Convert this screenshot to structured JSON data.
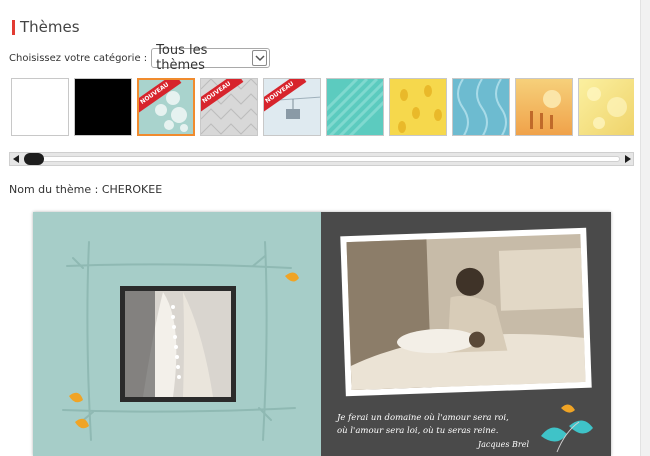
{
  "section": {
    "title": "Thèmes"
  },
  "category": {
    "label": "Choisissez votre catégorie :",
    "selected": "Tous les thèmes"
  },
  "thumbnails": [
    {
      "name": "white",
      "badge": ""
    },
    {
      "name": "black",
      "badge": ""
    },
    {
      "name": "cherokee",
      "badge": "NOUVEAU",
      "selected": true
    },
    {
      "name": "grey-geometric",
      "badge": "NOUVEAU"
    },
    {
      "name": "gondola",
      "badge": "NOUVEAU"
    },
    {
      "name": "teal-stripes",
      "badge": ""
    },
    {
      "name": "yellow-pineapples",
      "badge": ""
    },
    {
      "name": "blue-lattice",
      "badge": ""
    },
    {
      "name": "orange-sunset",
      "badge": ""
    },
    {
      "name": "yellow-bokeh",
      "badge": ""
    }
  ],
  "theme": {
    "label": "Nom du thème : CHEROKEE"
  },
  "preview": {
    "quote_line1": "Je ferai un domaine où l'amour sera roi,",
    "quote_line2": "où l'amour sera loi, où tu seras reine.",
    "quote_author": "Jacques Brel"
  },
  "colors": {
    "accent": "#e23b32",
    "selected_border": "#f08b2e",
    "left_page": "#a6cdc8",
    "right_page": "#4a4a4a"
  }
}
